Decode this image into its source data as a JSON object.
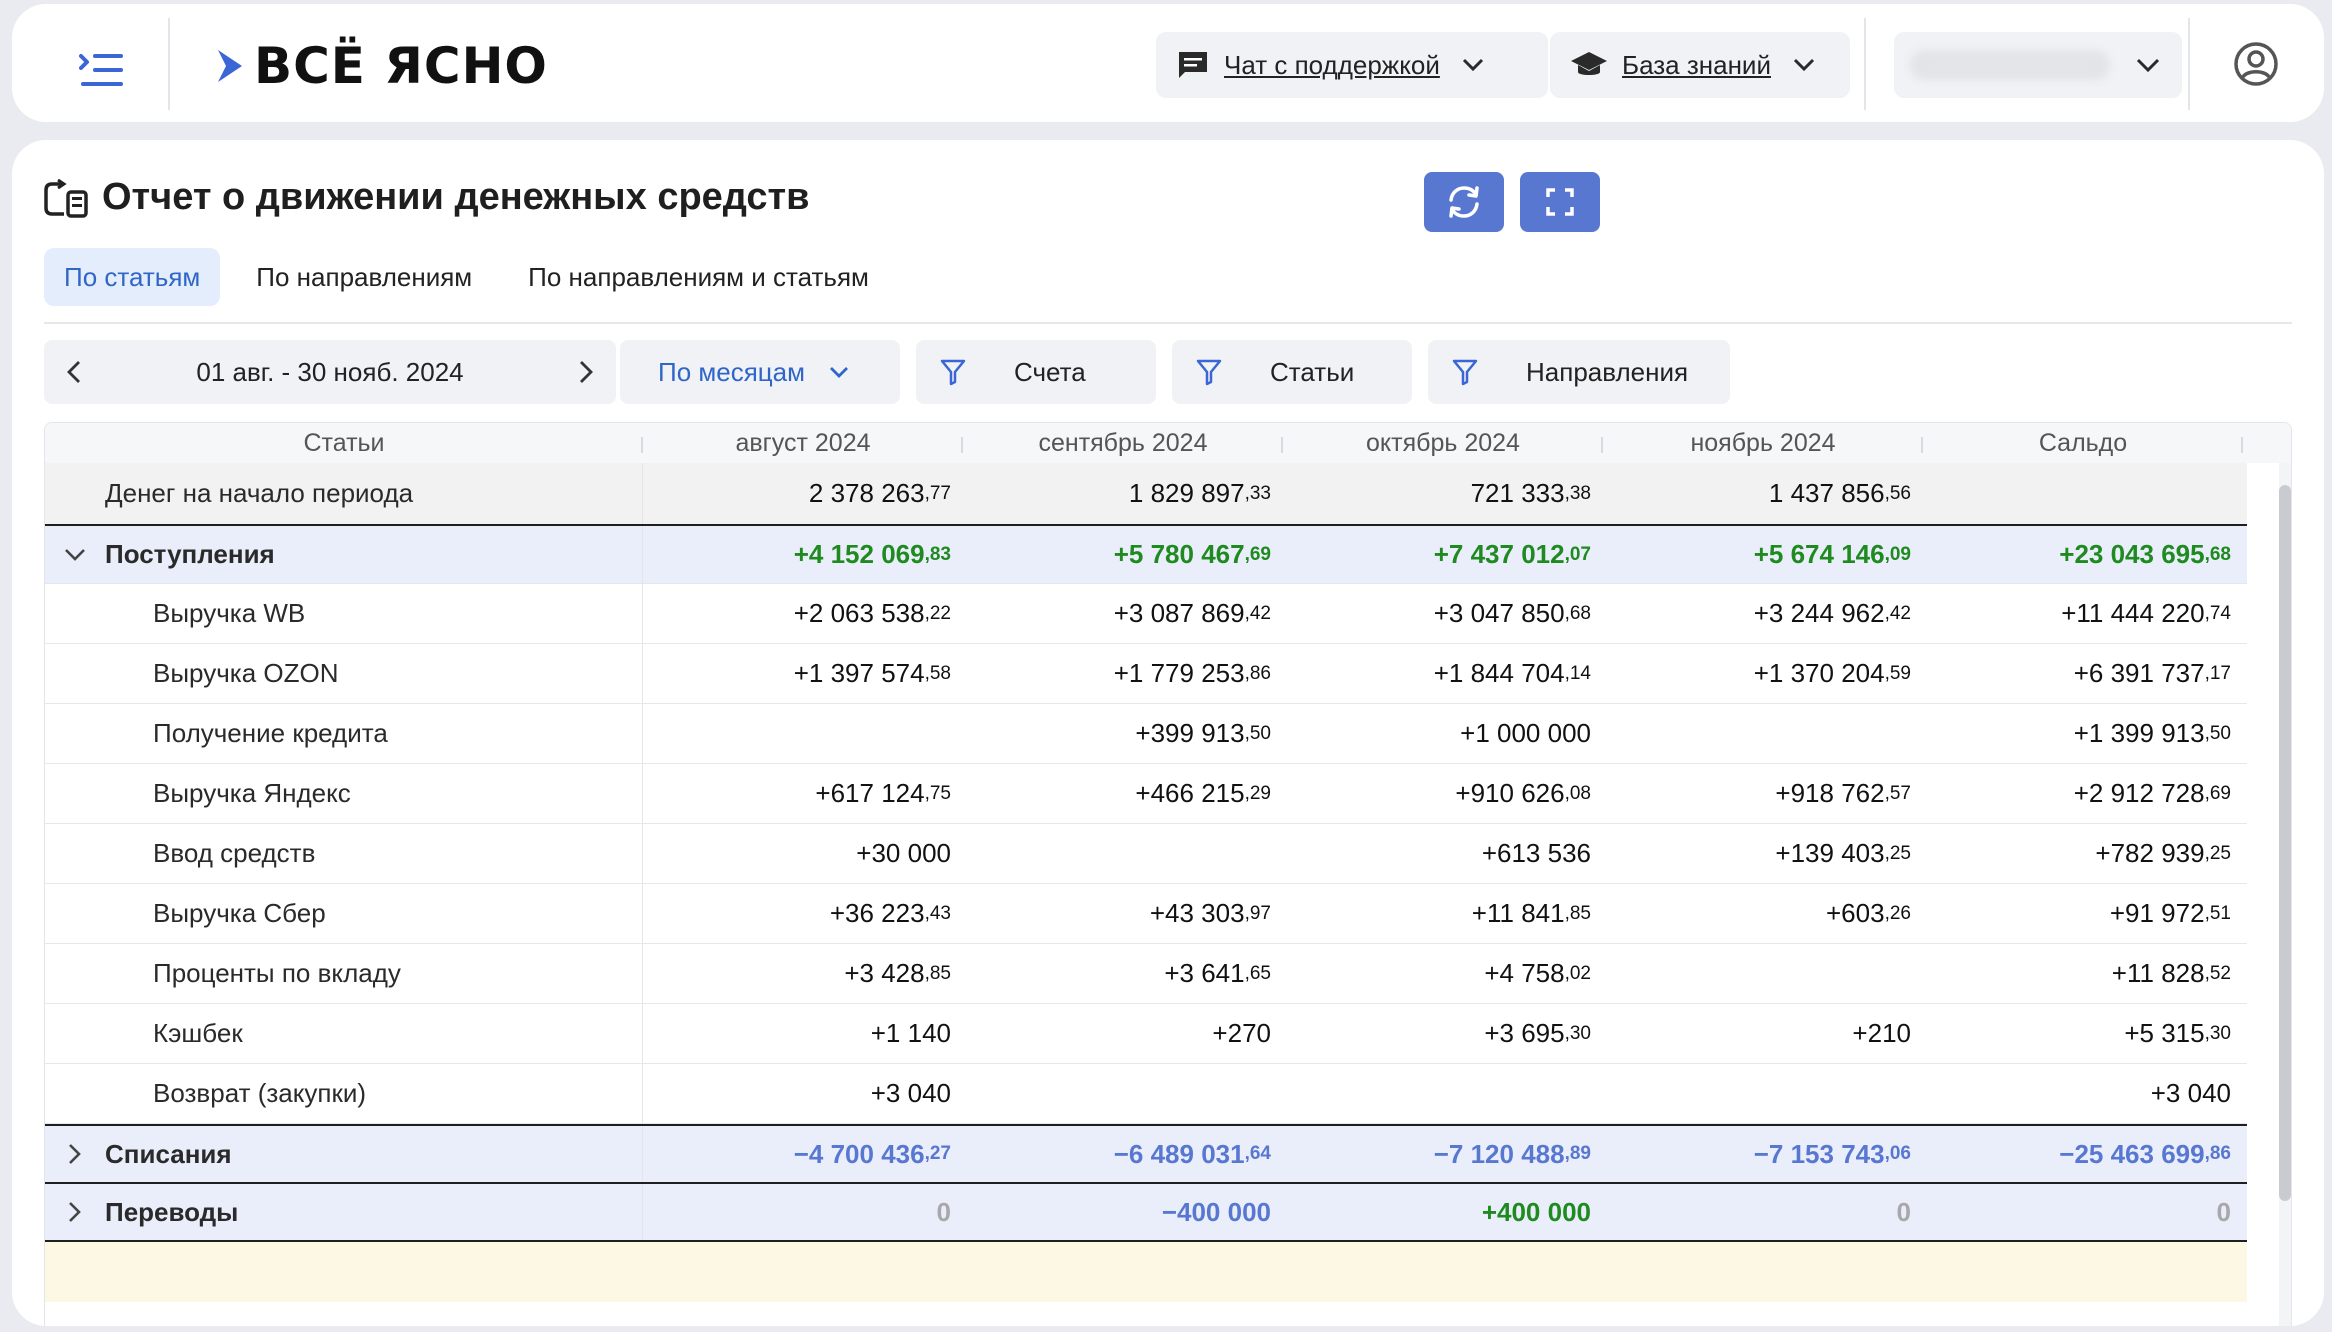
{
  "header": {
    "logo_text": "ВСЁ ЯСНО",
    "support_label": "Чат с поддержкой",
    "knowledge_label": "База знаний"
  },
  "page": {
    "title": "Отчет о движении денежных средств",
    "tabs": [
      "По статьям",
      "По направлениям",
      "По направлениям и статьям"
    ],
    "active_tab": 0
  },
  "filters": {
    "date_range": "01 авг. - 30 нояб. 2024",
    "period": "По месяцам",
    "accounts": "Счета",
    "articles": "Статьи",
    "directions": "Направления"
  },
  "table": {
    "columns": [
      "Статьи",
      "август 2024",
      "сентябрь 2024",
      "октябрь 2024",
      "ноябрь 2024",
      "Сальдо"
    ],
    "rows": [
      {
        "kind": "opening",
        "label": "Денег на начало периода",
        "values": [
          [
            "2 378 263",
            ",77"
          ],
          [
            "1 829 897",
            ",33"
          ],
          [
            "721 333",
            ",38"
          ],
          [
            "1 437 856",
            ",56"
          ],
          [
            "",
            ""
          ]
        ]
      },
      {
        "kind": "group",
        "label": "Поступления",
        "expanded": true,
        "tone": "pos",
        "values": [
          [
            "+4 152 069",
            ",83"
          ],
          [
            "+5 780 467",
            ",69"
          ],
          [
            "+7 437 012",
            ",07"
          ],
          [
            "+5 674 146",
            ",09"
          ],
          [
            "+23 043 695",
            ",68"
          ]
        ]
      },
      {
        "kind": "item",
        "label": "Выручка WB",
        "values": [
          [
            "+2 063 538",
            ",22"
          ],
          [
            "+3 087 869",
            ",42"
          ],
          [
            "+3 047 850",
            ",68"
          ],
          [
            "+3 244 962",
            ",42"
          ],
          [
            "+11 444 220",
            ",74"
          ]
        ]
      },
      {
        "kind": "item",
        "label": "Выручка OZON",
        "values": [
          [
            "+1 397 574",
            ",58"
          ],
          [
            "+1 779 253",
            ",86"
          ],
          [
            "+1 844 704",
            ",14"
          ],
          [
            "+1 370 204",
            ",59"
          ],
          [
            "+6 391 737",
            ",17"
          ]
        ]
      },
      {
        "kind": "item",
        "label": "Получение кредита",
        "values": [
          [
            "",
            ""
          ],
          [
            "+399 913",
            ",50"
          ],
          [
            "+1 000 000",
            ""
          ],
          [
            "",
            ""
          ],
          [
            "+1 399 913",
            ",50"
          ]
        ]
      },
      {
        "kind": "item",
        "label": "Выручка Яндекс",
        "values": [
          [
            "+617 124",
            ",75"
          ],
          [
            "+466 215",
            ",29"
          ],
          [
            "+910 626",
            ",08"
          ],
          [
            "+918 762",
            ",57"
          ],
          [
            "+2 912 728",
            ",69"
          ]
        ]
      },
      {
        "kind": "item",
        "label": "Ввод средств",
        "values": [
          [
            "+30 000",
            ""
          ],
          [
            "",
            ""
          ],
          [
            "+613 536",
            ""
          ],
          [
            "+139 403",
            ",25"
          ],
          [
            "+782 939",
            ",25"
          ]
        ]
      },
      {
        "kind": "item",
        "label": "Выручка Сбер",
        "values": [
          [
            "+36 223",
            ",43"
          ],
          [
            "+43 303",
            ",97"
          ],
          [
            "+11 841",
            ",85"
          ],
          [
            "+603",
            ",26"
          ],
          [
            "+91 972",
            ",51"
          ]
        ]
      },
      {
        "kind": "item",
        "label": "Проценты по вкладу",
        "values": [
          [
            "+3 428",
            ",85"
          ],
          [
            "+3 641",
            ",65"
          ],
          [
            "+4 758",
            ",02"
          ],
          [
            "",
            ""
          ],
          [
            "+11 828",
            ",52"
          ]
        ]
      },
      {
        "kind": "item",
        "label": "Кэшбек",
        "values": [
          [
            "+1 140",
            ""
          ],
          [
            "+270",
            ""
          ],
          [
            "+3 695",
            ",30"
          ],
          [
            "+210",
            ""
          ],
          [
            "+5 315",
            ",30"
          ]
        ]
      },
      {
        "kind": "item",
        "label": "Возврат (закупки)",
        "values": [
          [
            "+3 040",
            ""
          ],
          [
            "",
            ""
          ],
          [
            "",
            ""
          ],
          [
            "",
            ""
          ],
          [
            "+3 040",
            ""
          ]
        ]
      },
      {
        "kind": "group",
        "label": "Списания",
        "expanded": false,
        "tone": "neg",
        "values": [
          [
            "−4 700 436",
            ",27"
          ],
          [
            "−6 489 031",
            ",64"
          ],
          [
            "−7 120 488",
            ",89"
          ],
          [
            "−7 153 743",
            ",06"
          ],
          [
            "−25 463 699",
            ",86"
          ]
        ]
      },
      {
        "kind": "group",
        "label": "Переводы",
        "expanded": false,
        "tone": "mixed",
        "values": [
          [
            "0",
            ""
          ],
          [
            "−400 000",
            ""
          ],
          [
            "+400 000",
            ""
          ],
          [
            "0",
            ""
          ],
          [
            "0",
            ""
          ]
        ]
      }
    ]
  },
  "colors": {
    "accent": "#5877d1",
    "positive": "#1f8a1f",
    "negative": "#5877d1",
    "zero": "#a8a8a8"
  }
}
